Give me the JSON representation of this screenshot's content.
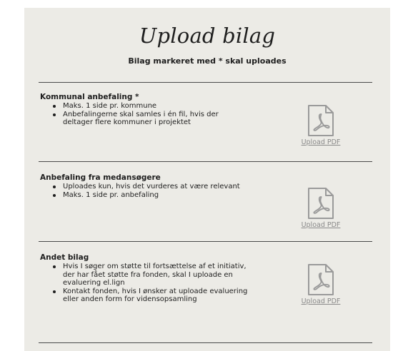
{
  "page": {
    "title": "Upload bilag",
    "subtitle": "Bilag markeret med * skal uploades"
  },
  "sections": [
    {
      "title": "Kommunal anbefaling  *",
      "bullets": [
        "Maks. 1 side pr. kommune",
        "Anbefalingerne skal samles i én fil, hvis der deltager flere kommuner i projektet"
      ],
      "upload_label": "Upload PDF"
    },
    {
      "title": "Anbefaling fra medansøgere",
      "bullets": [
        "Uploades kun, hvis det vurderes at være relevant",
        "Maks. 1 side pr. anbefaling"
      ],
      "upload_label": "Upload PDF"
    },
    {
      "title": "Andet bilag",
      "bullets": [
        "Hvis I søger om støtte til fortsættelse af et initiativ, der har fået støtte fra fonden, skal I uploade en evaluering el.lign",
        "Kontakt fonden, hvis I ønsker at uploade evaluering eller anden form for vidensopsamling"
      ],
      "upload_label": "Upload PDF"
    }
  ],
  "icons": {
    "upload": "pdf-file-icon"
  },
  "colors": {
    "panel_background": "#ecebe6",
    "link": "#8a8a8a",
    "divider": "#4a4a4a"
  }
}
